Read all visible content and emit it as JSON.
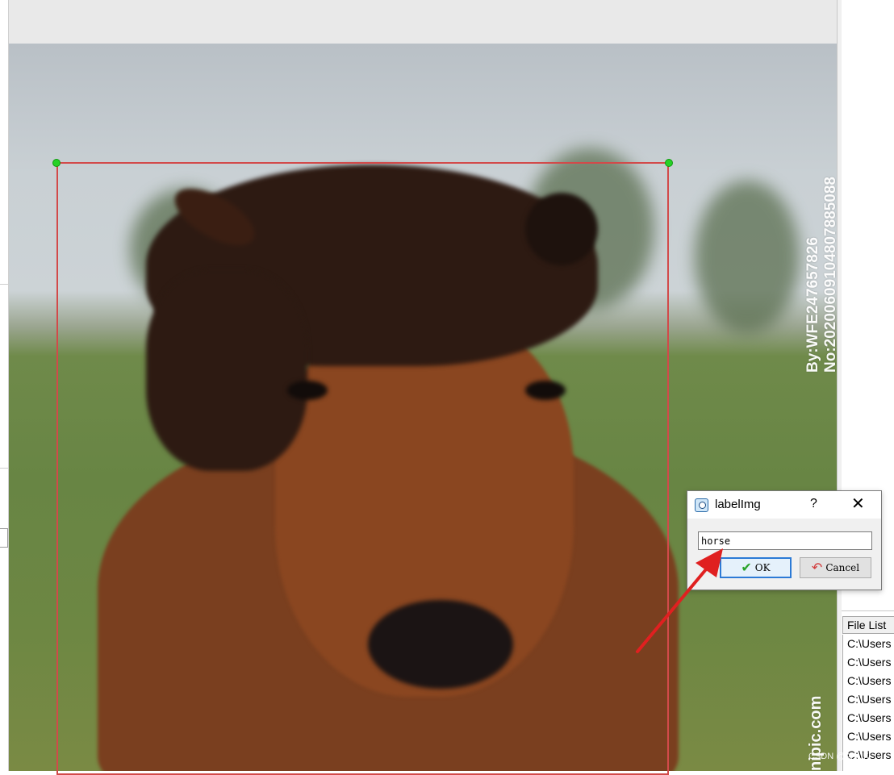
{
  "dialog": {
    "title": "labelImg",
    "help_label": "?",
    "close_label": "✕",
    "input_value": "horse",
    "ok_label": "OK",
    "cancel_label": "Cancel",
    "icons": {
      "app": "labelimg-app-icon",
      "ok": "check-icon",
      "cancel": "undo-icon"
    }
  },
  "file_list": {
    "header": "File List",
    "items": [
      "C:\\Users",
      "C:\\Users",
      "C:\\Users",
      "C:\\Users",
      "C:\\Users",
      "C:\\Users",
      "C:\\Users"
    ]
  },
  "image": {
    "watermark_vertical": "By:WFE247657826 No:20200609104807885088",
    "watermark_brand": "nipic.com",
    "footer_watermark": "CSDN @AAUK"
  },
  "annotation": {
    "box_color": "#d24a4a",
    "handle_color": "#26d126",
    "arrow_color": "#e02020"
  }
}
